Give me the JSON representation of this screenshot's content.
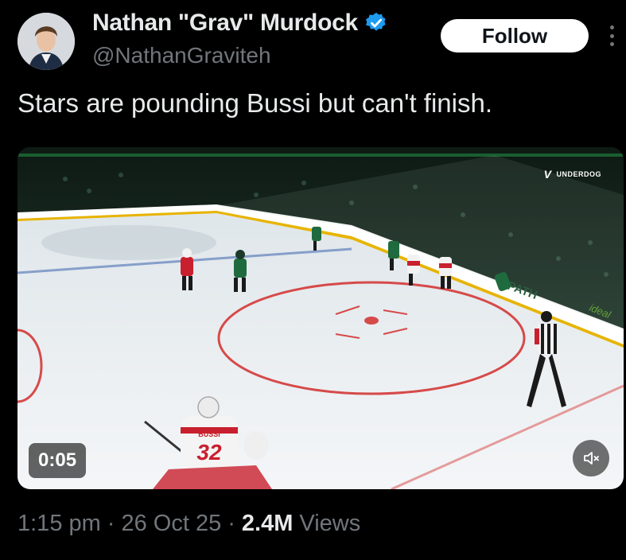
{
  "user": {
    "display_name": "Nathan \"Grav\" Murdock",
    "handle": "@NathanGraviteh"
  },
  "follow_label": "Follow",
  "tweet_text": "Stars are pounding Bussi but can't finish.",
  "video": {
    "duration": "0:05",
    "watermark_text": "UNDERDOG",
    "jersey_name": "BUSSI",
    "jersey_number": "32",
    "board_ad": "PATH",
    "board_ad_2": "ideal"
  },
  "meta": {
    "time": "1:15 pm",
    "date": "26 Oct 25",
    "views_count": "2.4M",
    "views_label": "Views"
  },
  "colors": {
    "verified": "#1d9bf0",
    "muted_text": "#71767b",
    "primary_text": "#e7e9ea",
    "background": "#000000"
  },
  "icons": [
    "verified-badge-icon",
    "more-options-icon",
    "mute-speaker-icon"
  ]
}
